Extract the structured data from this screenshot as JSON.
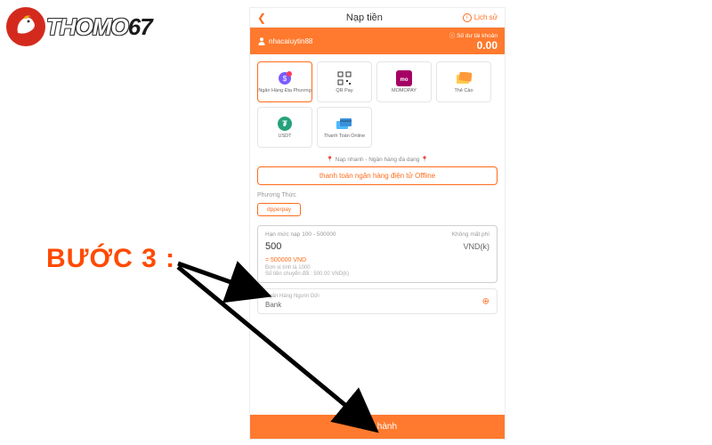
{
  "logo": {
    "text_a": "THOMO",
    "text_b": "67"
  },
  "header": {
    "title": "Nạp tiền",
    "history_label": "Lịch sử"
  },
  "user": {
    "username": "nhacaiuytin88",
    "balance_label": "Số dư tài khoản",
    "balance_value": "0.00"
  },
  "methods": [
    {
      "label": "Ngân Hàng Địa Phương",
      "icon": "bank-local"
    },
    {
      "label": "QR Pay",
      "icon": "qr"
    },
    {
      "label": "MOMOPAY",
      "icon": "momo"
    },
    {
      "label": "Thẻ Cào",
      "icon": "card"
    },
    {
      "label": "USDT",
      "icon": "usdt"
    },
    {
      "label": "Thanh Toán Online",
      "icon": "online"
    }
  ],
  "tagline": "Nạp nhanh - Ngân hàng đa dạng",
  "offline_button": "thanh toán ngân hàng điện tử Offline",
  "provider": {
    "section_label": "Phương Thức",
    "chip": "dpperpay"
  },
  "amount": {
    "limit_text": "Hạn mức nạp 100 - 500000",
    "fee_text": "Không mất phí",
    "value": "500",
    "unit": "VND(k)",
    "converted": "= 500000 VND",
    "note1": "Đơn vị tính là 1000",
    "note2": "Số tiền chuyển đổi : 500.00 VND(k)"
  },
  "bank": {
    "label": "Ngân Hàng Người Gửi",
    "value": "Bank"
  },
  "proceed_label": "Tiến hành",
  "callout": "BƯỚC 3 :"
}
